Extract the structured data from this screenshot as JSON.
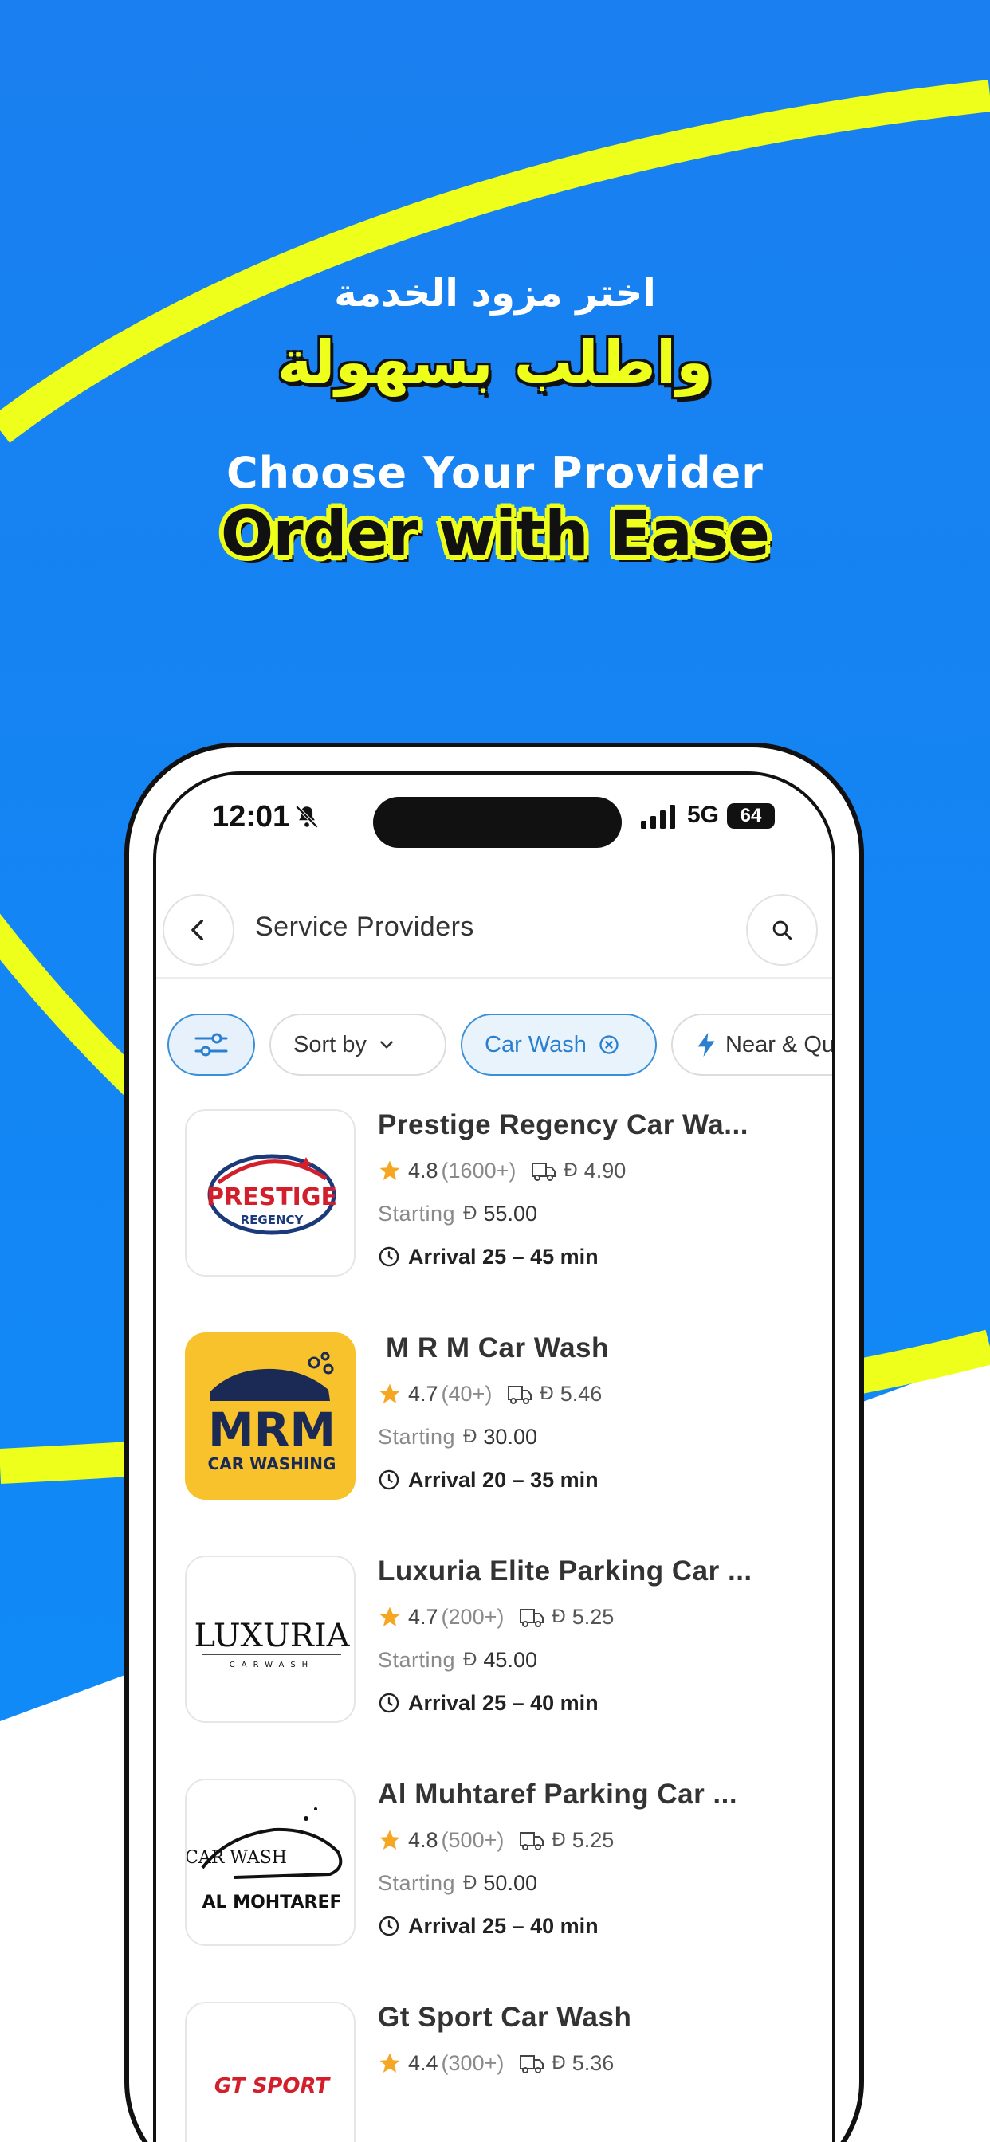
{
  "hero": {
    "arabic_line1": "اختر مزود الخدمة",
    "arabic_line2": "واطلب بسهولة",
    "english_line1": "Choose Your Provider",
    "english_line2": "Order with Ease"
  },
  "status_bar": {
    "time": "12:01",
    "network": "5G",
    "battery": "64"
  },
  "header": {
    "title": "Service Providers"
  },
  "filters": {
    "sort_label": "Sort by",
    "active_filter": "Car Wash",
    "near_label": "Near & Qu"
  },
  "currency_symbol": "Đ",
  "providers": [
    {
      "name": "Prestige Regency Car Wa...",
      "rating": "4.8",
      "reviews": "(1600+)",
      "delivery_fee": "4.90",
      "starting_label": "Starting",
      "starting_price": "55.00",
      "arrival": "Arrival 25 – 45 min",
      "logo_text": [
        "PRESTIGE",
        "REGENCY"
      ]
    },
    {
      "name": "M R M Car Wash",
      "rating": "4.7",
      "reviews": "(40+)",
      "delivery_fee": "5.46",
      "starting_label": "Starting",
      "starting_price": "30.00",
      "arrival": "Arrival 20 – 35 min",
      "logo_text": [
        "MRM",
        "CAR WASHING"
      ]
    },
    {
      "name": "Luxuria Elite Parking Car ...",
      "rating": "4.7",
      "reviews": "(200+)",
      "delivery_fee": "5.25",
      "starting_label": "Starting",
      "starting_price": "45.00",
      "arrival": "Arrival 25 – 40 min",
      "logo_text": [
        "LUXURIA",
        "CARWASH"
      ]
    },
    {
      "name": "Al Muhtaref Parking Car ...",
      "rating": "4.8",
      "reviews": "(500+)",
      "delivery_fee": "5.25",
      "starting_label": "Starting",
      "starting_price": "50.00",
      "arrival": "Arrival 25 – 40 min",
      "logo_text": [
        "CAR WASH",
        "AL MOHTAREF"
      ]
    },
    {
      "name": "Gt Sport Car Wash",
      "rating": "4.4",
      "reviews": "(300+)",
      "delivery_fee": "5.36",
      "logo_text": [
        "GT SPORT"
      ]
    }
  ],
  "colors": {
    "background_blue": "#1a84f4",
    "accent_yellow": "#eeff1b",
    "chip_active": "#3a8fd8",
    "star": "#f5a623"
  }
}
